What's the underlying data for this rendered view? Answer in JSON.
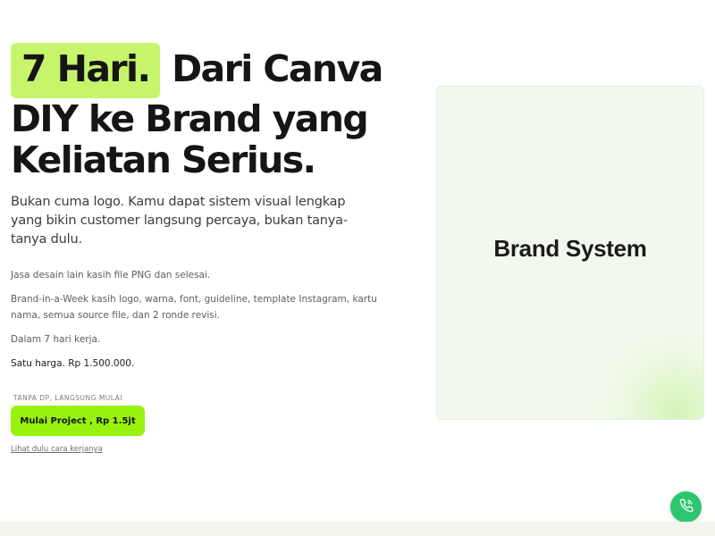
{
  "hero": {
    "headline_highlight": "7 Hari.",
    "headline_line1_rest": " Dari Canva",
    "headline_line2": "DIY ke Brand yang",
    "headline_line3": "Keliatan Serius.",
    "subhead": "Bukan cuma logo. Kamu dapat sistem visual lengkap yang bikin customer langsung percaya, bukan tanya-tanya dulu.",
    "paragraph1": "Jasa desain lain kasih file PNG dan selesai.",
    "paragraph2": "Brand-in-a-Week kasih logo, warna, font, guideline, template Instagram, kartu nama, semua source file, dan 2 ronde revisi.",
    "paragraph3": "Dalam 7 hari kerja.",
    "price_line": "Satu harga. Rp 1.500.000.",
    "note": "TANPA DP, LANGSUNG MULAI",
    "cta_label": "Mulai Project , Rp 1.5jt",
    "secondary_link": "Lihat dulu cara kerjanya"
  },
  "card": {
    "title": "Brand System"
  },
  "floating_button": {
    "icon": "phone-icon"
  },
  "colors": {
    "highlight": "#c6f56b",
    "cta": "#98f20e",
    "card_bg": "#f3f8ef",
    "fab": "#2dc66f"
  }
}
